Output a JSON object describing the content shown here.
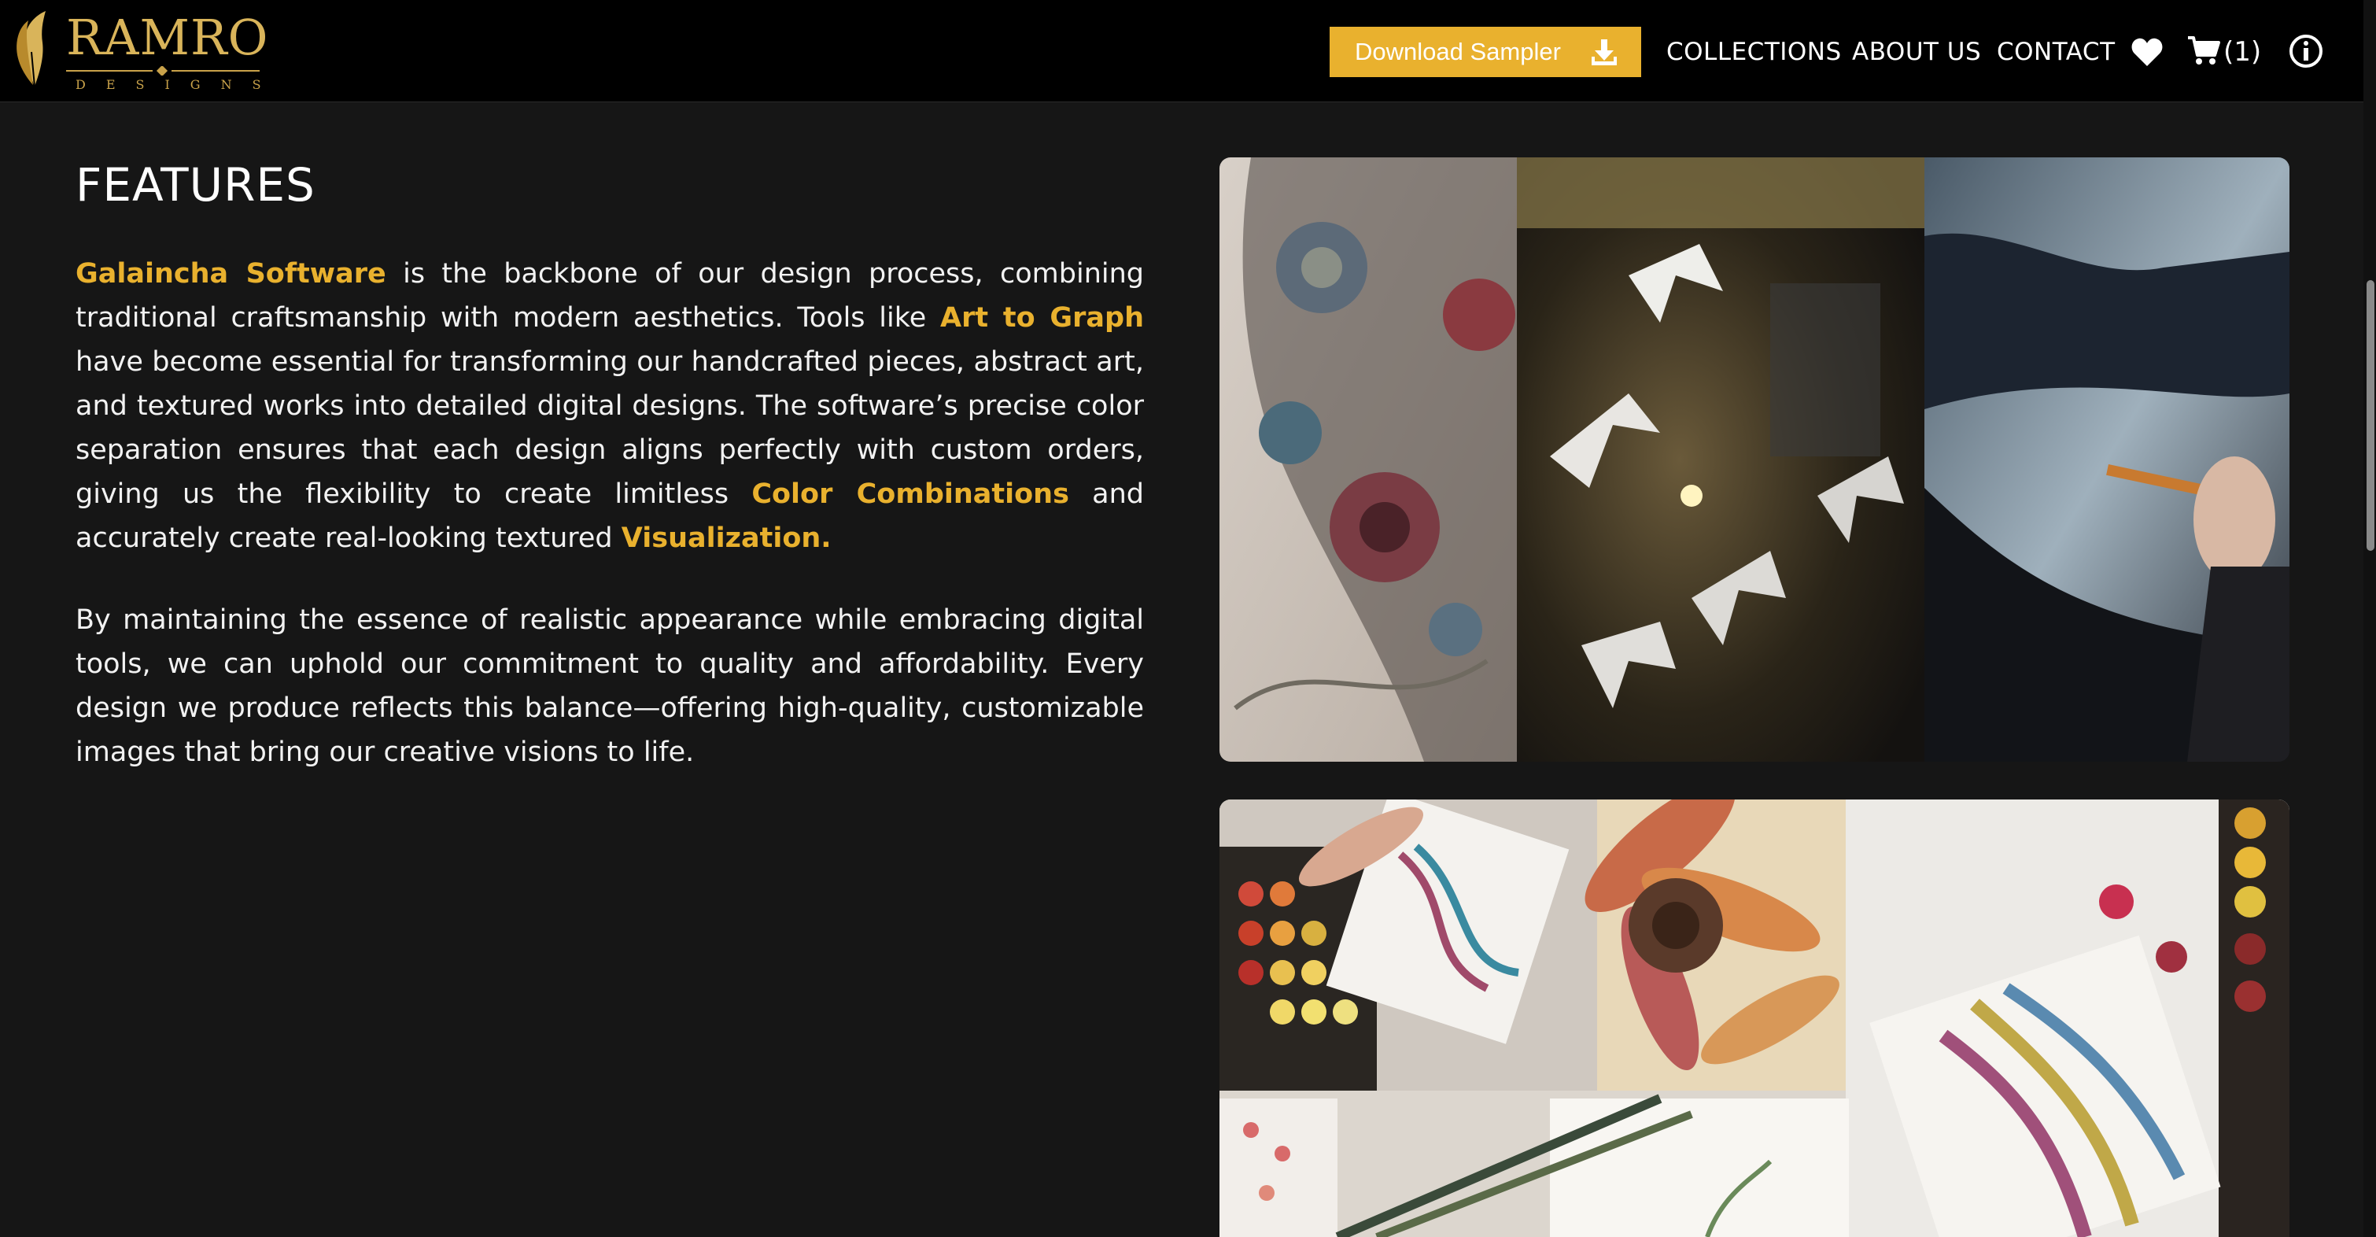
{
  "header": {
    "logo": {
      "wordmark": "RAMRO",
      "subline": "DESIGNS"
    },
    "download_button": {
      "label": "Download Sampler"
    },
    "nav": {
      "collections": "COLLECTIONS",
      "about": "ABOUT US",
      "contact": "CONTACT"
    },
    "cart_count": "(1)",
    "icons": [
      "feather-logo-icon",
      "download-icon",
      "heart-icon",
      "cart-icon",
      "info-icon"
    ]
  },
  "features": {
    "title": "FEATURES",
    "p1": {
      "link_1": "Galaincha Software",
      "t1": " is the backbone of our design process, combining traditional craftsmanship with modern aesthetics. Tools like ",
      "link_2": "Art to Graph",
      "t2": " have become essential for transforming our handcrafted pieces, abstract art, and textured works into detailed digital designs. The software’s precise color separation ensures that each design aligns perfectly with custom orders, giving us the flexibility to create limitless ",
      "link_3": "Color Combinations",
      "t3": " and accurately create real-looking textured ",
      "link_4": "Visualization."
    },
    "p2": "By maintaining the essence of realistic appearance while embracing digital tools, we can uphold our commitment to quality and affordability. Every design we produce reflects this balance—offering high-quality, customizable images that bring our creative visions to life."
  },
  "colors": {
    "accent": "#e9b12e",
    "header_bg": "#000000",
    "page_bg": "#161616",
    "logo_gold": "#d9b45a"
  }
}
